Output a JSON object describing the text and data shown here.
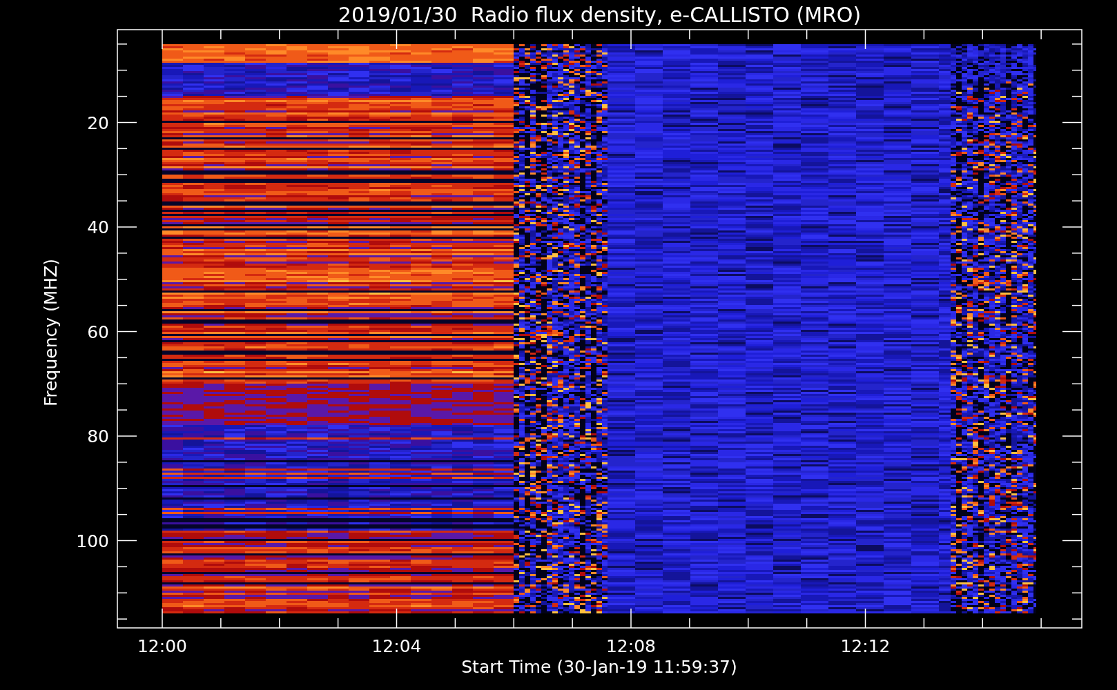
{
  "plot": {
    "title": "2019/01/30  Radio flux density, e-CALLISTO (MRO)",
    "ylabel": "Frequency (MHZ)",
    "yticks": [
      "20",
      "40",
      "60",
      "80",
      "100"
    ],
    "xticks": [
      "12:00",
      "12:04",
      "12:08",
      "12:12"
    ],
    "xlabel": "Start Time (30-Jan-19 11:59:37)"
  }
}
